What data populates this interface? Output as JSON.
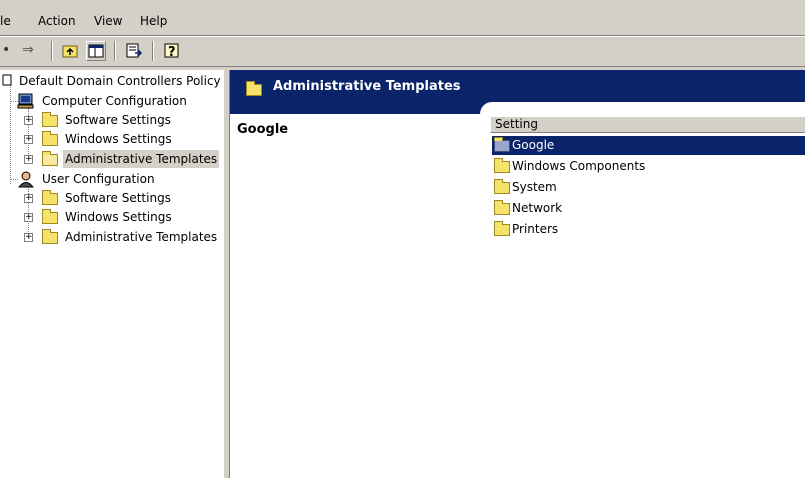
{
  "menu": {
    "file_partial": "le",
    "action": "Action",
    "view": "View",
    "help": "Help"
  },
  "toolbar": {
    "back_glyph": "⇢",
    "forward_glyph": "⇒"
  },
  "tree": {
    "root": "Default Domain Controllers Policy [",
    "computer_configuration": "Computer Configuration",
    "cc_software_settings": "Software Settings",
    "cc_windows_settings": "Windows Settings",
    "cc_administrative_templates": "Administrative Templates",
    "user_configuration": "User Configuration",
    "uc_software_settings": "Software Settings",
    "uc_windows_settings": "Windows Settings",
    "uc_administrative_templates": "Administrative Templates"
  },
  "main": {
    "banner_title": "Administrative Templates",
    "content_title": "Google",
    "column_header": "Setting",
    "items": [
      "Google",
      "Windows Components",
      "System",
      "Network",
      "Printers"
    ]
  },
  "colors": {
    "selection": "#0a246a",
    "folder": "#f5e26b",
    "chrome": "#d4d0c8"
  }
}
